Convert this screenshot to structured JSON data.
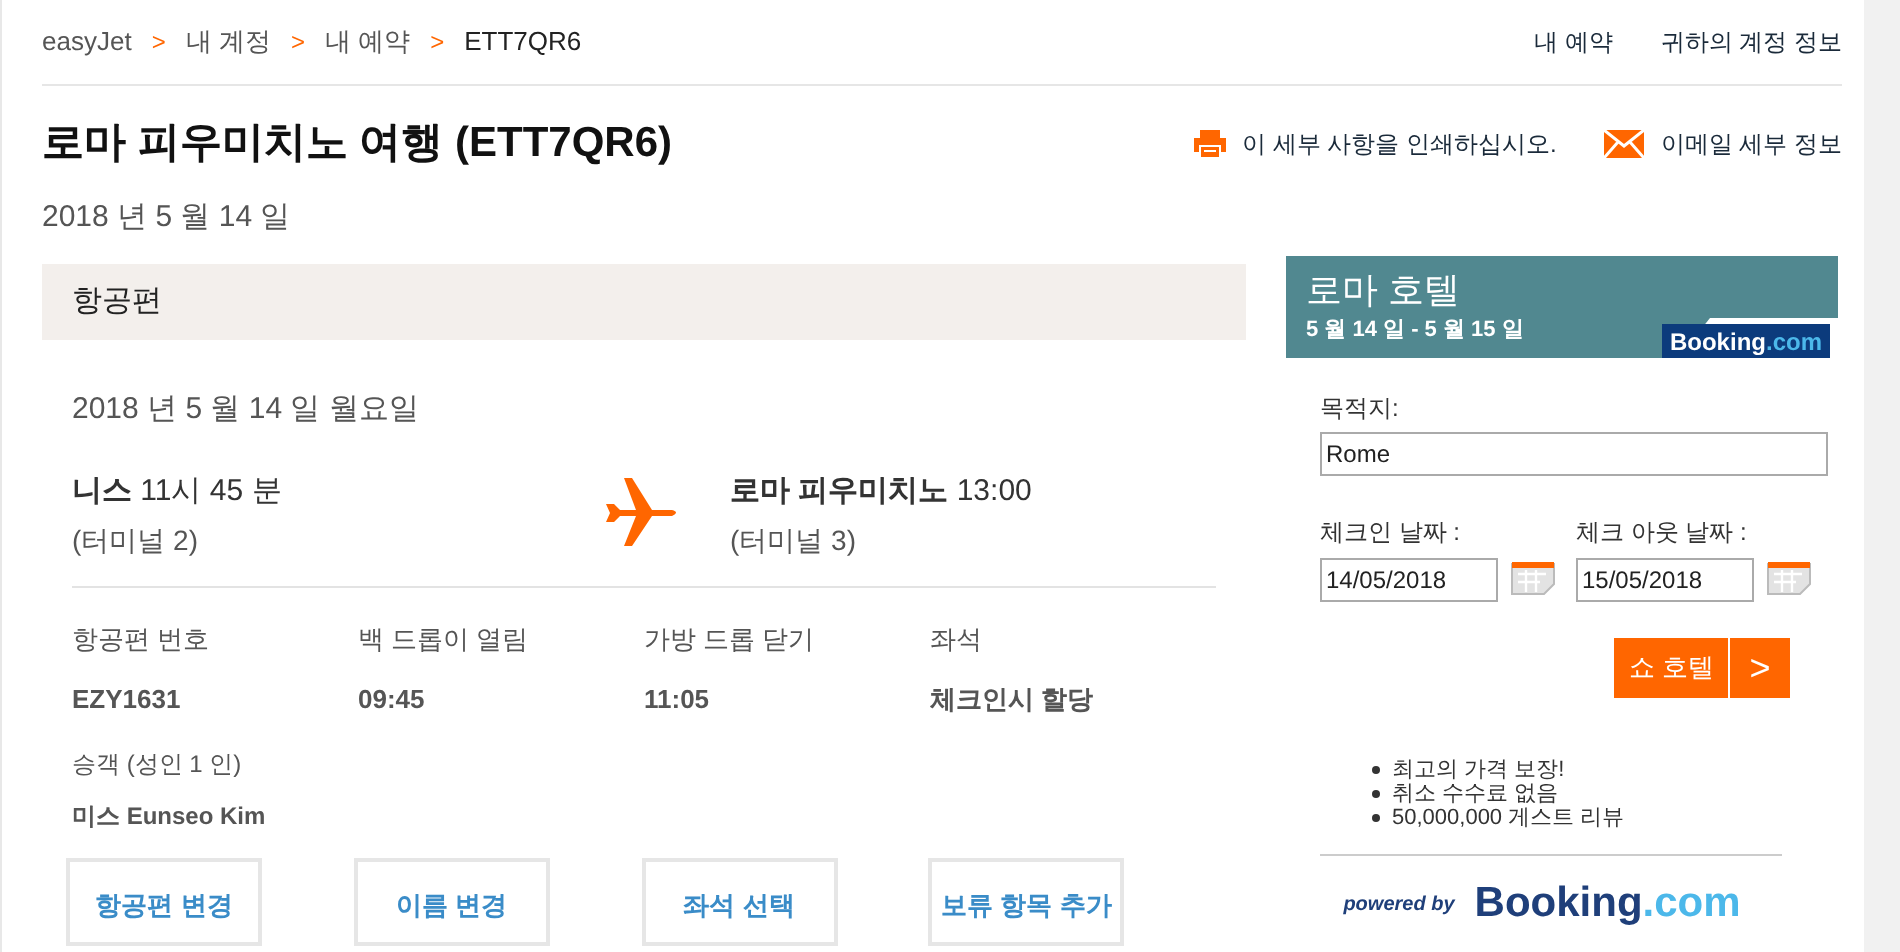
{
  "breadcrumb": [
    {
      "label": "easyJet",
      "current": false
    },
    {
      "label": "내 계정",
      "current": false
    },
    {
      "label": "내 예약",
      "current": false
    },
    {
      "label": "ETT7QR6",
      "current": true
    }
  ],
  "breadcrumb_separator": ">",
  "top_links": [
    "내 예약",
    "귀하의 계정 정보"
  ],
  "title": "로마 피우미치노 여행 (ETT7QR6)",
  "date": "2018 년 5 월 14 일",
  "actions": [
    {
      "kind": "print",
      "label": "이 세부 사항을 인쇄하십시오."
    },
    {
      "kind": "email",
      "label": "이메일 세부 정보"
    }
  ],
  "flight": {
    "header": "항공편",
    "date": "2018 년 5 월 14 일 월요일",
    "departure": {
      "place": "니스",
      "time": "11시 45 분",
      "terminal": "(터미널 2)"
    },
    "arrival": {
      "place": "로마 피우미치노",
      "time": "13:00",
      "terminal": "(터미널 3)"
    },
    "details": [
      {
        "label": "항공편 번호",
        "value": "EZY1631"
      },
      {
        "label": "백 드롭이 열림",
        "value": "09:45"
      },
      {
        "label": "가방 드롭 닫기",
        "value": "11:05"
      },
      {
        "label": "좌석",
        "value": "체크인시 할당"
      }
    ],
    "passengers_label": "승객 (성인 1 인)",
    "passenger": "미스 Eunseo Kim",
    "buttons": [
      "항공편 변경",
      "이름 변경",
      "좌석 선택",
      "보류 항목 추가"
    ]
  },
  "hotel": {
    "title": "로마 호텔",
    "dates": "5 월 14 일 - 5 월 15 일",
    "logo": {
      "brand": "Booking",
      "tld": ".com"
    },
    "destination_label": "목적지:",
    "destination": "Rome",
    "checkin_label": "체크인 날짜 :",
    "checkin": "14/05/2018",
    "checkout_label": "체크 아웃 날짜 :",
    "checkout": "15/05/2018",
    "button": "쇼 호텔",
    "button_arrow": ">",
    "benefits": [
      "최고의 가격 보장!",
      "취소 수수료 없음",
      "50,000,000 게스트 리뷰"
    ],
    "powered_by": "powered by",
    "powered_logo": {
      "brand": "Booking",
      "tld": ".com"
    }
  }
}
